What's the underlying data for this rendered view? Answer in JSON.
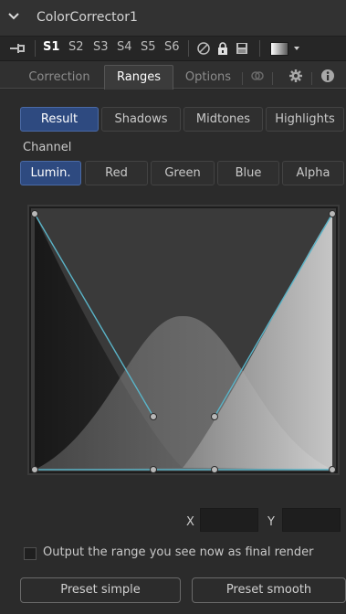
{
  "header": {
    "title": "ColorCorrector1"
  },
  "toolbar": {
    "slots": [
      "S1",
      "S2",
      "S3",
      "S4",
      "S5",
      "S6"
    ],
    "active_slot": "S1"
  },
  "tabs": [
    {
      "label": "Correction"
    },
    {
      "label": "Ranges"
    },
    {
      "label": "Options"
    }
  ],
  "active_tab": "Ranges",
  "range_buttons": [
    {
      "label": "Result"
    },
    {
      "label": "Shadows"
    },
    {
      "label": "Midtones"
    },
    {
      "label": "Highlights"
    }
  ],
  "active_range": "Result",
  "channel": {
    "label": "Channel",
    "options": [
      {
        "label": "Lumin."
      },
      {
        "label": "Red"
      },
      {
        "label": "Green"
      },
      {
        "label": "Blue"
      },
      {
        "label": "Alpha"
      }
    ],
    "active": "Lumin."
  },
  "coords": {
    "x_label": "X",
    "y_label": "Y",
    "x_value": "",
    "y_value": ""
  },
  "output_checkbox": {
    "label": "Output the range you see now as final render",
    "checked": false
  },
  "presets": {
    "simple": "Preset simple",
    "smooth": "Preset smooth"
  },
  "colors": {
    "accent": "#2e4a80",
    "curve": "#5ab4c8",
    "panel_bg": "#2b2b2b"
  },
  "icons": [
    "collapse-chevron-icon",
    "pin-icon",
    "disable-icon",
    "lock-icon",
    "save-icon",
    "gradient-swatch-icon",
    "dropdown-arrow-icon",
    "link-icon",
    "gear-icon",
    "info-icon"
  ]
}
